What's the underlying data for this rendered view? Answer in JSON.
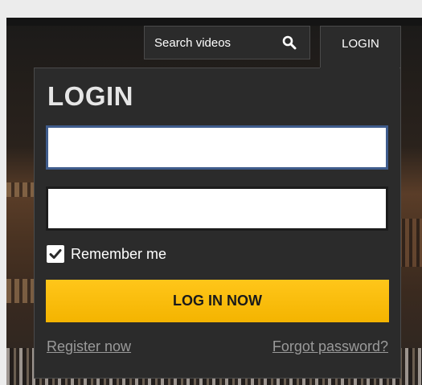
{
  "header": {
    "search": {
      "label": "Search videos",
      "icon": "search-icon"
    },
    "login_tab": "LOGIN"
  },
  "login_panel": {
    "title": "LOGIN",
    "username": {
      "value": "",
      "placeholder": ""
    },
    "password": {
      "value": "",
      "placeholder": ""
    },
    "remember_me": {
      "label": "Remember me",
      "checked": true
    },
    "submit_label": "LOG IN NOW",
    "register_link": "Register now",
    "forgot_link": "Forgot password?"
  },
  "colors": {
    "panel_bg": "#2b2b2b",
    "button": "#ffc61a",
    "link": "#9a9a9a",
    "input_focus_border": "#3f5c8c"
  }
}
